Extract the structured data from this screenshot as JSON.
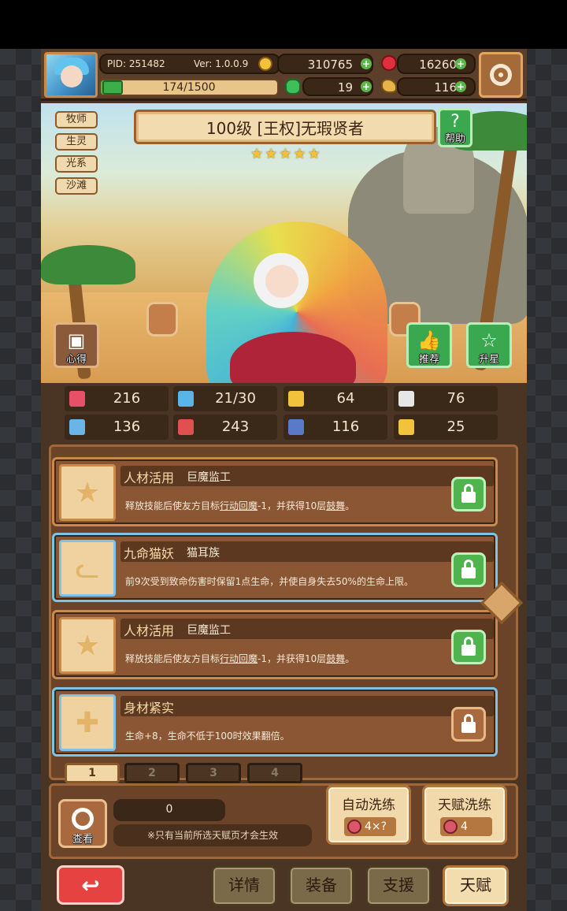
{
  "header": {
    "pid": "PID: 251482",
    "version": "Ver: 1.0.0.9",
    "coins": "310765",
    "gems": "16260",
    "xp": "174/1500",
    "xp_fraction": 0.116,
    "clover": "19",
    "food": "116"
  },
  "hero": {
    "title": "100级 [王权]无瑕贤者",
    "stars": 5,
    "tags": [
      "牧师",
      "生灵",
      "光系",
      "沙滩"
    ],
    "help_label": "帮助",
    "notes_label": "心得",
    "recommend_label": "推荐",
    "upgrade_star_label": "升星"
  },
  "stats": [
    {
      "icon": "heart-icon",
      "value": "216",
      "color": "#e8506a"
    },
    {
      "icon": "drop-icon",
      "value": "21/30",
      "color": "#5ab4e8"
    },
    {
      "icon": "shield-icon",
      "value": "64",
      "color": "#f2c23c"
    },
    {
      "icon": "wing-icon",
      "value": "76",
      "color": "#e6e6e6"
    },
    {
      "icon": "fist-icon",
      "value": "136",
      "color": "#6ab4e8"
    },
    {
      "icon": "book-icon",
      "value": "243",
      "color": "#e05050"
    },
    {
      "icon": "boot-icon",
      "value": "116",
      "color": "#5a7ac8"
    },
    {
      "icon": "horseshoe-icon",
      "value": "25",
      "color": "#f2c23c"
    }
  ],
  "talents": [
    {
      "name": "人材活用",
      "sub": "巨魔监工",
      "desc_pre": "释放技能后使友方目标",
      "desc_link1": "行动回魔",
      "desc_mid": "-1，并获得10层",
      "desc_link2": "鼓舞",
      "desc_post": "。",
      "icon": "star-icon",
      "locked": true
    },
    {
      "name": "九命猫妖",
      "sub": "猫耳族",
      "desc_pre": "前9次受到致命伤害时保留1点生命，并使自身失去50%的生命上限。",
      "desc_link1": "",
      "desc_mid": "",
      "desc_link2": "",
      "desc_post": "",
      "icon": "cat-icon",
      "locked": true
    },
    {
      "name": "人材活用",
      "sub": "巨魔监工",
      "desc_pre": "释放技能后使友方目标",
      "desc_link1": "行动回魔",
      "desc_mid": "-1，并获得10层",
      "desc_link2": "鼓舞",
      "desc_post": "。",
      "icon": "star-icon",
      "locked": true
    },
    {
      "name": "身材紧实",
      "sub": "",
      "desc_pre": "生命+8，生命不低于100时效果翻倍。",
      "desc_link1": "",
      "desc_mid": "",
      "desc_link2": "",
      "desc_post": "",
      "icon": "cross-icon",
      "locked": false
    }
  ],
  "pages": [
    "1",
    "2",
    "3",
    "4"
  ],
  "bottom": {
    "view_label": "查看",
    "fruit_count": "0",
    "note": "※只有当前所选天赋页才会生效",
    "auto_wash_label": "自动洗练",
    "auto_wash_cost": "4×?",
    "talent_wash_label": "天赋洗练",
    "talent_wash_cost": "4"
  },
  "nav": {
    "back_symbol": "↩",
    "details": "详情",
    "equipment": "装备",
    "support": "支援",
    "talent": "天赋"
  }
}
